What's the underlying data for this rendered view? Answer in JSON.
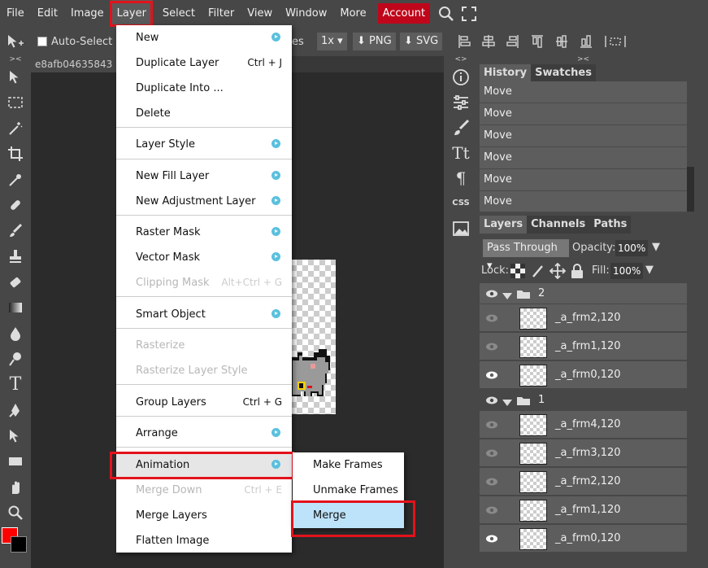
{
  "menubar": {
    "items": [
      "File",
      "Edit",
      "Image",
      "Layer",
      "Select",
      "Filter",
      "View",
      "Window",
      "More"
    ],
    "account": "Account",
    "accent_color": "#c0061b",
    "icons": [
      "search-icon",
      "fullscreen-icon"
    ]
  },
  "options": {
    "auto_select": "Auto-Select",
    "truncated": "es",
    "zoom": "1x",
    "png": "PNG",
    "svg": "SVG"
  },
  "document": {
    "tab": "e8afb04635843"
  },
  "layer_menu": {
    "items": [
      {
        "label": "New",
        "submenu": true
      },
      {
        "label": "Duplicate Layer",
        "shortcut": "Ctrl + J"
      },
      {
        "label": "Duplicate Into ..."
      },
      {
        "label": "Delete"
      },
      {
        "label": "Layer Style",
        "submenu": true
      },
      {
        "label": "New Fill Layer",
        "submenu": true
      },
      {
        "label": "New Adjustment Layer",
        "submenu": true
      },
      {
        "label": "Raster Mask",
        "submenu": true
      },
      {
        "label": "Vector Mask",
        "submenu": true
      },
      {
        "label": "Clipping Mask",
        "shortcut": "Alt+Ctrl + G",
        "disabled": true
      },
      {
        "label": "Smart Object",
        "submenu": true
      },
      {
        "label": "Rasterize",
        "disabled": true
      },
      {
        "label": "Rasterize Layer Style",
        "disabled": true
      },
      {
        "label": "Group Layers",
        "shortcut": "Ctrl + G"
      },
      {
        "label": "Arrange",
        "submenu": true
      },
      {
        "label": "Animation",
        "submenu": true
      },
      {
        "label": "Merge Down",
        "shortcut": "Ctrl + E",
        "disabled": true
      },
      {
        "label": "Merge Layers"
      },
      {
        "label": "Flatten Image"
      }
    ]
  },
  "animation_submenu": {
    "items": [
      "Make Frames",
      "Unmake Frames",
      "Merge"
    ]
  },
  "history": {
    "tabs": [
      "History",
      "Swatches"
    ],
    "entries": [
      "Move",
      "Move",
      "Move",
      "Move",
      "Move",
      "Move"
    ]
  },
  "layers_panel": {
    "tabs": [
      "Layers",
      "Channels",
      "Paths"
    ],
    "blend_mode": "Pass Through",
    "opacity_label": "Opacity:",
    "opacity": "100%",
    "lock_label": "Lock:",
    "fill_label": "Fill:",
    "fill": "100%",
    "rows": [
      {
        "type": "group",
        "name": "2",
        "visible": true
      },
      {
        "type": "layer",
        "name": "_a_frm2,120",
        "visible": false
      },
      {
        "type": "layer",
        "name": "_a_frm1,120",
        "visible": false
      },
      {
        "type": "layer",
        "name": "_a_frm0,120",
        "visible": true
      },
      {
        "type": "group",
        "name": "1",
        "visible": true
      },
      {
        "type": "layer",
        "name": "_a_frm4,120",
        "visible": false
      },
      {
        "type": "layer",
        "name": "_a_frm3,120",
        "visible": false
      },
      {
        "type": "layer",
        "name": "_a_frm2,120",
        "visible": false
      },
      {
        "type": "layer",
        "name": "_a_frm1,120",
        "visible": false
      },
      {
        "type": "layer",
        "name": "_a_frm0,120",
        "visible": true
      }
    ]
  },
  "colors": {
    "foreground": "#ff0000",
    "background": "#000000",
    "highlight": "#e3121b"
  }
}
